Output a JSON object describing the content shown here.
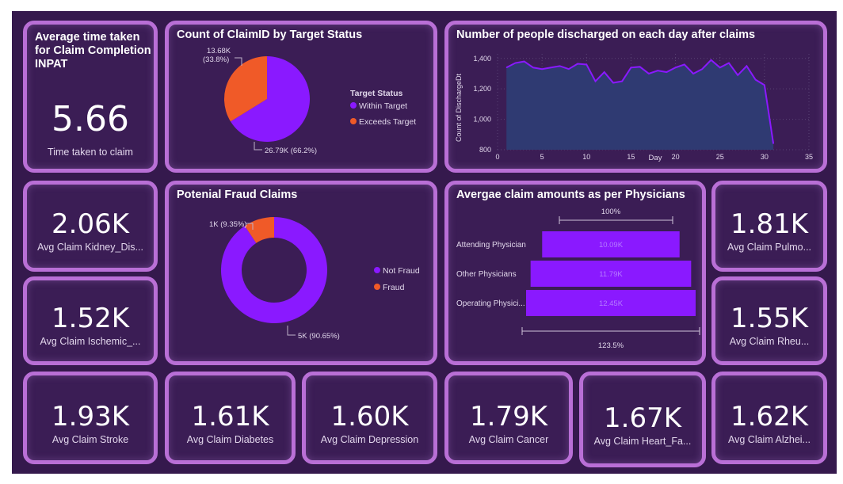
{
  "inpat_card": {
    "title": "Average time taken for Claim Completion INPAT",
    "value": "5.66",
    "label": "Time taken to claim"
  },
  "kpis": {
    "kidney": {
      "value": "2.06K",
      "label": "Avg Claim Kidney_Dis..."
    },
    "ischemic": {
      "value": "1.52K",
      "label": "Avg Claim Ischemic_..."
    },
    "pulmo": {
      "value": "1.81K",
      "label": "Avg Claim Pulmo..."
    },
    "rheu": {
      "value": "1.55K",
      "label": "Avg Claim Rheu..."
    },
    "stroke": {
      "value": "1.93K",
      "label": "Avg Claim Stroke"
    },
    "diabetes": {
      "value": "1.61K",
      "label": "Avg Claim Diabetes"
    },
    "depression": {
      "value": "1.60K",
      "label": "Avg Claim Depression"
    },
    "cancer": {
      "value": "1.79K",
      "label": "Avg Claim Cancer"
    },
    "heart": {
      "value": "1.67K",
      "label": "Avg Claim Heart_Fa..."
    },
    "alzhei": {
      "value": "1.62K",
      "label": "Avg Claim Alzhei..."
    }
  },
  "colors": {
    "purple": "#8a19ff",
    "orange": "#f05a28",
    "area": "#2f3a72",
    "border": "#b96fd6"
  },
  "chart_data": [
    {
      "type": "pie",
      "title": "Count of ClaimID by Target Status",
      "legend_title": "Target Status",
      "legend_position": "right",
      "slices": [
        {
          "name": "Within Target",
          "value": 26790,
          "label": "26.79K (66.2%)",
          "color": "#8a19ff"
        },
        {
          "name": "Exceeds Target",
          "value": 13680,
          "label_line1": "13.68K",
          "label_line2": "(33.8%)",
          "color": "#f05a28"
        }
      ]
    },
    {
      "type": "line",
      "title": "Number of people discharged on each day after claims",
      "xlabel": "Day",
      "ylabel": "Count of DischargeDt",
      "xlim": [
        0,
        35
      ],
      "ylim": [
        800,
        1430
      ],
      "xticks": [
        0,
        5,
        10,
        15,
        20,
        25,
        30,
        35
      ],
      "yticks": [
        800,
        1000,
        1200,
        1400
      ],
      "ytick_labels": [
        "800",
        "1,000",
        "1,200",
        "1,400"
      ],
      "grid": true,
      "x": [
        1,
        2,
        3,
        4,
        5,
        6,
        7,
        8,
        9,
        10,
        11,
        12,
        13,
        14,
        15,
        16,
        17,
        18,
        19,
        20,
        21,
        22,
        23,
        24,
        25,
        26,
        27,
        28,
        29,
        30,
        31
      ],
      "values": [
        1340,
        1370,
        1380,
        1340,
        1330,
        1340,
        1350,
        1330,
        1365,
        1360,
        1250,
        1310,
        1240,
        1250,
        1340,
        1345,
        1300,
        1320,
        1310,
        1340,
        1360,
        1300,
        1330,
        1390,
        1340,
        1370,
        1290,
        1350,
        1260,
        1225,
        840
      ]
    },
    {
      "type": "donut",
      "title": "Potenial Fraud Claims",
      "legend_position": "right",
      "slices": [
        {
          "name": "Not Fraud",
          "value": 90.65,
          "label": "5K (90.65%)",
          "color": "#8a19ff"
        },
        {
          "name": "Fraud",
          "value": 9.35,
          "label": "1K (9.35%)",
          "color": "#f05a28"
        }
      ]
    },
    {
      "type": "bar",
      "subtype": "funnel",
      "title": "Avergae claim amounts as per Physicians",
      "top_label": "100%",
      "bottom_label": "123.5%",
      "categories": [
        "Attending Physician",
        "Other Physicians",
        "Operating Physici..."
      ],
      "values": [
        10.09,
        11.79,
        12.45
      ],
      "value_labels": [
        "10.09K",
        "11.79K",
        "12.45K"
      ]
    }
  ]
}
